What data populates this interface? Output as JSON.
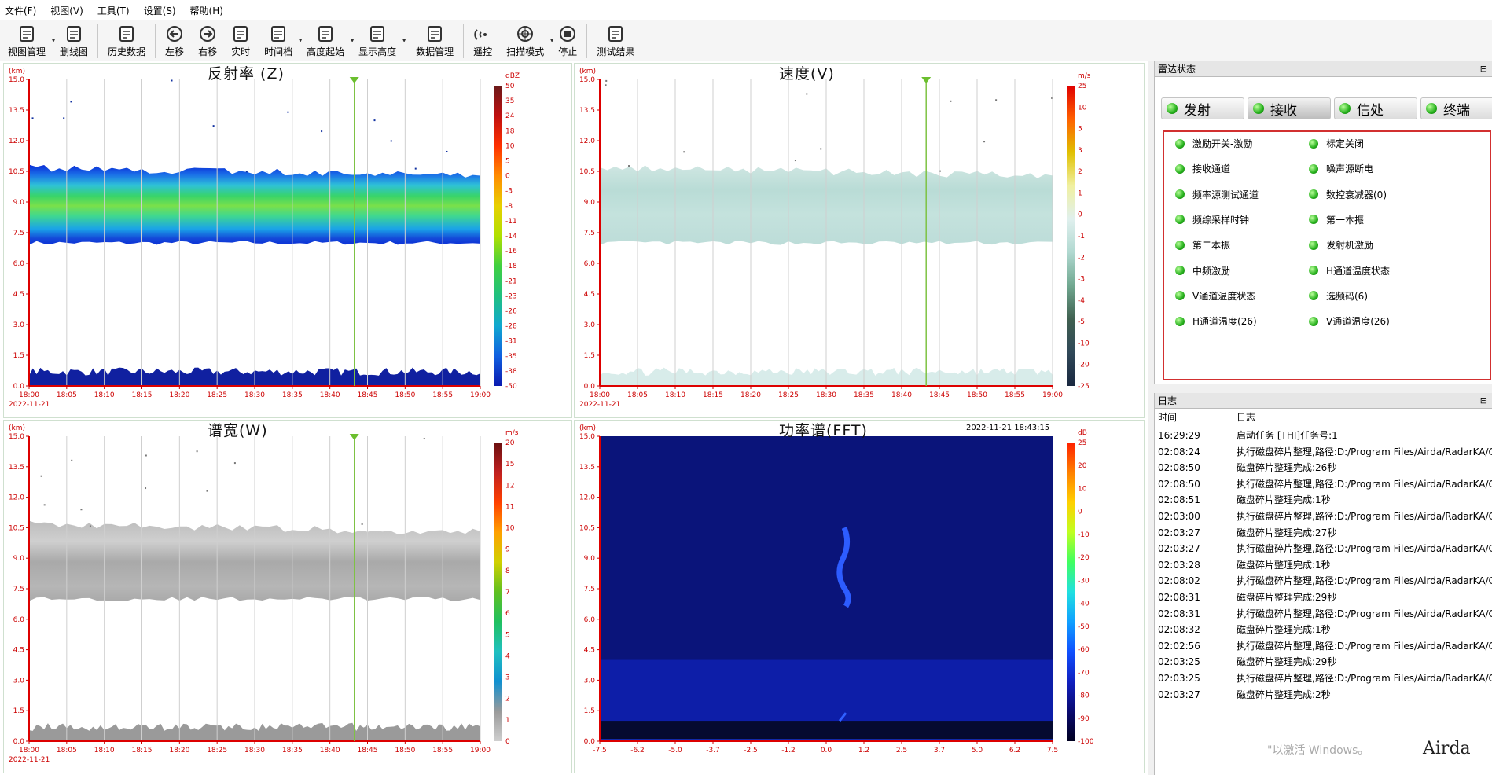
{
  "menu": [
    "文件(F)",
    "视图(V)",
    "工具(T)",
    "设置(S)",
    "帮助(H)"
  ],
  "toolbar": [
    {
      "label": "视图管理",
      "icon": "view-manage-icon",
      "dropdown": true
    },
    {
      "label": "删线图",
      "icon": "window-icon",
      "dropdown": false
    },
    {
      "label": "历史数据",
      "icon": "history-data-icon",
      "dropdown": false
    },
    {
      "label": "左移",
      "icon": "arrow-left-icon",
      "dropdown": false
    },
    {
      "label": "右移",
      "icon": "arrow-right-icon",
      "dropdown": false
    },
    {
      "label": "实时",
      "icon": "realtime-icon",
      "dropdown": false
    },
    {
      "label": "时间档",
      "icon": "time-range-icon",
      "dropdown": true
    },
    {
      "label": "高度起始",
      "icon": "height-start-icon",
      "dropdown": true
    },
    {
      "label": "显示高度",
      "icon": "display-height-icon",
      "dropdown": true
    },
    {
      "label": "数据管理",
      "icon": "data-manage-icon",
      "dropdown": false
    },
    {
      "label": "遥控",
      "icon": "remote-control-icon",
      "dropdown": false
    },
    {
      "label": "扫描模式",
      "icon": "scan-mode-icon",
      "dropdown": true
    },
    {
      "label": "停止",
      "icon": "stop-icon",
      "dropdown": false
    },
    {
      "label": "测试结果",
      "icon": "test-result-icon",
      "dropdown": false
    }
  ],
  "plots": {
    "reflectivity": {
      "title": "反射率 (Z)",
      "unit": "dBZ",
      "colorbar": [
        "50",
        "35",
        "24",
        "18",
        "10",
        "5",
        "0",
        "-3",
        "-8",
        "-11",
        "-14",
        "-16",
        "-18",
        "-21",
        "-23",
        "-26",
        "-28",
        "-31",
        "-35",
        "-38",
        "-50"
      ]
    },
    "velocity": {
      "title": "速度(V)",
      "unit": "m/s",
      "colorbar": [
        "25",
        "10",
        "5",
        "3",
        "2",
        "1",
        "0",
        "-1",
        "-2",
        "-3",
        "-4",
        "-5",
        "-10",
        "-20",
        "-25"
      ]
    },
    "spectrum_width": {
      "title": "谱宽(W)",
      "unit": "m/s",
      "colorbar": [
        "20",
        "15",
        "12",
        "11",
        "10",
        "9",
        "8",
        "7",
        "6",
        "5",
        "4",
        "3",
        "2",
        "1",
        "0"
      ]
    },
    "fft": {
      "title": "功率谱(FFT)",
      "timestamp": "2022-11-21  18:43:15",
      "unit": "dB",
      "colorbar": [
        "25",
        "20",
        "10",
        "0",
        "-10",
        "-20",
        "-30",
        "-40",
        "-50",
        "-60",
        "-70",
        "-80",
        "-90",
        "-100"
      ],
      "x_ticks": [
        "-7.5",
        "-6.2",
        "-5.0",
        "-3.7",
        "-2.5",
        "-1.2",
        "0.0",
        "1.2",
        "2.5",
        "3.7",
        "5.0",
        "6.2",
        "7.5"
      ]
    },
    "y_unit": "(km)",
    "y_ticks": [
      "15.0",
      "13.5",
      "12.0",
      "10.5",
      "9.0",
      "7.5",
      "6.0",
      "4.5",
      "3.0",
      "1.5",
      "0.0"
    ],
    "x_ticks": [
      "18:00",
      "18:05",
      "18:10",
      "18:15",
      "18:20",
      "18:25",
      "18:30",
      "18:35",
      "18:40",
      "18:45",
      "18:50",
      "18:55",
      "19:00"
    ],
    "date": "2022-11-21",
    "cursor_time": "18:43:15"
  },
  "radar_status": {
    "title": "雷达状态",
    "tabs": [
      "发射",
      "接收",
      "信处",
      "终端"
    ],
    "active_tab": "接收",
    "items": [
      "激励开关-激励",
      "标定关闭",
      "接收通道",
      "噪声源断电",
      "频率源测试通道",
      "数控衰减器(0)",
      "频综采样时钟",
      "第一本振",
      "第二本振",
      "发射机激励",
      "中频激励",
      "H通道温度状态",
      "V通道温度状态",
      "选频码(6)",
      "H通道温度(26)",
      "V通道温度(26)"
    ]
  },
  "log": {
    "title": "日志",
    "headers": [
      "时间",
      "日志"
    ],
    "rows": [
      [
        "16:29:29",
        "启动任务 [THI]任务号:1"
      ],
      [
        "02:08:24",
        "执行磁盘碎片整理,路径:D:/Program Files/Airda/RadarKA/C"
      ],
      [
        "02:08:50",
        "磁盘碎片整理完成:26秒"
      ],
      [
        "02:08:50",
        "执行磁盘碎片整理,路径:D:/Program Files/Airda/RadarKA/C"
      ],
      [
        "02:08:51",
        "磁盘碎片整理完成:1秒"
      ],
      [
        "02:03:00",
        "执行磁盘碎片整理,路径:D:/Program Files/Airda/RadarKA/C"
      ],
      [
        "02:03:27",
        "磁盘碎片整理完成:27秒"
      ],
      [
        "02:03:27",
        "执行磁盘碎片整理,路径:D:/Program Files/Airda/RadarKA/C"
      ],
      [
        "02:03:28",
        "磁盘碎片整理完成:1秒"
      ],
      [
        "02:08:02",
        "执行磁盘碎片整理,路径:D:/Program Files/Airda/RadarKA/C"
      ],
      [
        "02:08:31",
        "磁盘碎片整理完成:29秒"
      ],
      [
        "02:08:31",
        "执行磁盘碎片整理,路径:D:/Program Files/Airda/RadarKA/C"
      ],
      [
        "02:08:32",
        "磁盘碎片整理完成:1秒"
      ],
      [
        "02:02:56",
        "执行磁盘碎片整理,路径:D:/Program Files/Airda/RadarKA/C"
      ],
      [
        "02:03:25",
        "磁盘碎片整理完成:29秒"
      ],
      [
        "02:03:25",
        "执行磁盘碎片整理,路径:D:/Program Files/Airda/RadarKA/C"
      ],
      [
        "02:03:27",
        "磁盘碎片整理完成:2秒"
      ]
    ]
  },
  "watermark": "\"以激活 Windows。",
  "watermark_brand": "Airda"
}
